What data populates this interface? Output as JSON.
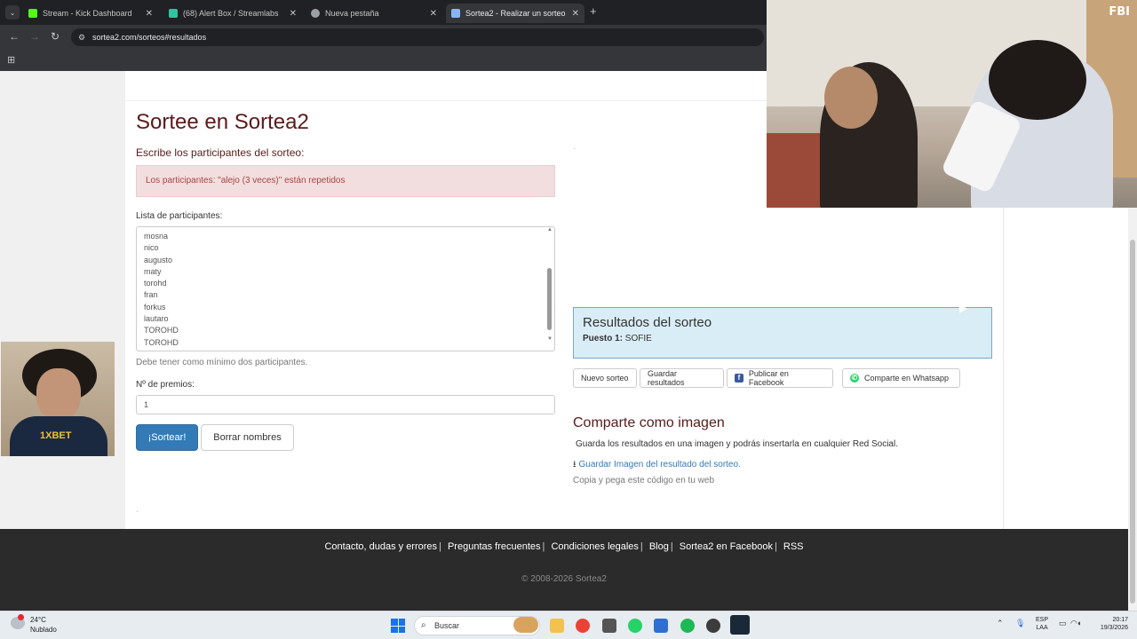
{
  "browser": {
    "tabs": [
      {
        "title": "Stream - Kick Dashboard",
        "color": "#53fc18"
      },
      {
        "title": "(68) Alert Box / Streamlabs",
        "color": "#31c3a2"
      },
      {
        "title": "Nueva pestaña",
        "color": "#9aa0a6"
      },
      {
        "title": "Sortea2 - Realizar un sorteo",
        "color": "#8ab4f8"
      }
    ],
    "url": "sortea2.com/sorteos#resultados"
  },
  "overlay": {
    "cam_tag": "FBI",
    "shirt_logo": "1XBET"
  },
  "form": {
    "title": "Sortee en Sortea2",
    "subtitle": "Escribe los participantes del sorteo:",
    "alert": "Los participantes: \"alejo (3 veces)\" están repetidos",
    "list_label": "Lista de participantes:",
    "participants": [
      "mosna",
      "nico",
      "augusto",
      "maty",
      "torohd",
      "fran",
      "forkus",
      "lautaro",
      "TOROHD",
      "TOROHD"
    ],
    "help": "Debe tener como mínimo dos participantes.",
    "prizes_label": "Nº de premios:",
    "prizes_value": "1",
    "draw_button": "¡Sortear!",
    "clear_button": "Borrar nombres"
  },
  "results": {
    "title": "Resultados del sorteo",
    "position_label": "Puesto 1:",
    "winner": "SOFIE",
    "buttons": {
      "new": "Nuevo sorteo",
      "save": "Guardar resultados",
      "facebook": "Publicar en Facebook",
      "whatsapp": "Comparte en Whatsapp"
    }
  },
  "share": {
    "title": "Comparte como imagen",
    "description": "Guarda los resultados en una imagen y podrás insertarla en cualquier Red Social.",
    "save_link": "Guardar Imagen del resultado del sorteo.",
    "copy_text": "Copia y pega este código en tu web"
  },
  "footer": {
    "links": [
      "Contacto, dudas y errores",
      "Preguntas frecuentes",
      "Condiciones legales",
      "Blog",
      "Sortea2 en Facebook",
      "RSS"
    ],
    "copyright": "© 2008-2026 Sortea2"
  },
  "taskbar": {
    "weather_temp": "24°C",
    "weather_cond": "Nublado",
    "search_placeholder": "Buscar",
    "lang_top": "ESP",
    "lang_bottom": "LAA",
    "time": "20:17",
    "date": "19/3/2026"
  }
}
